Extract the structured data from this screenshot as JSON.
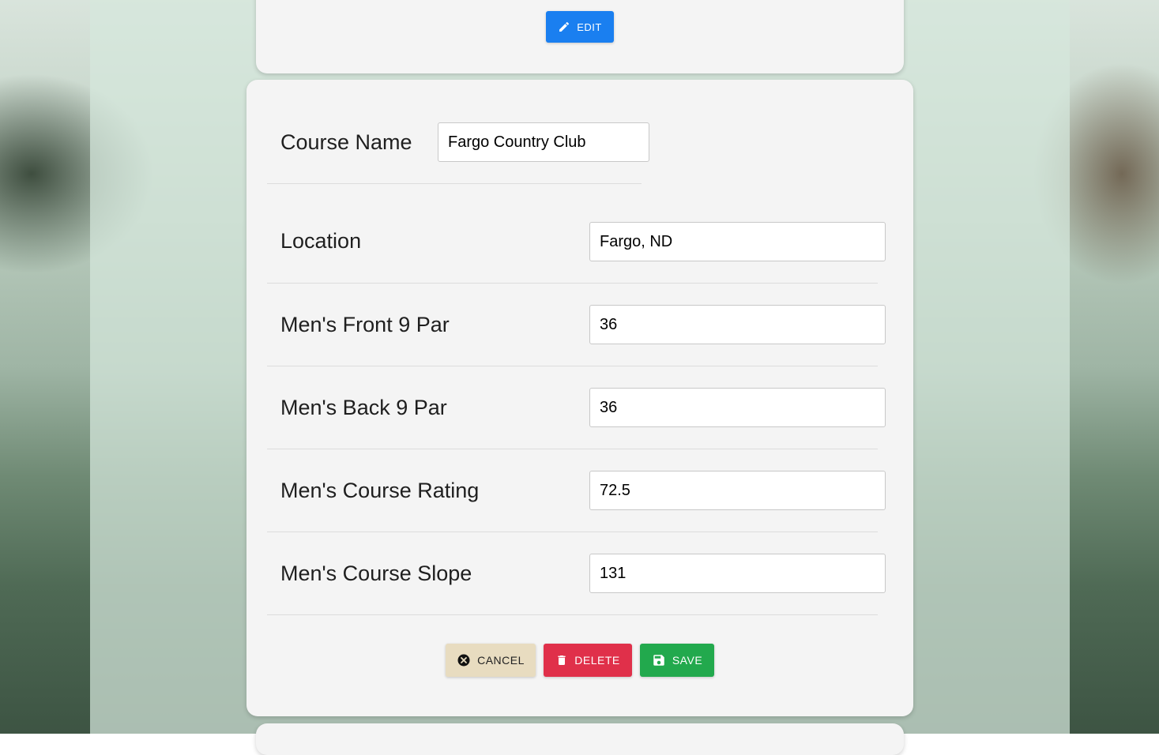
{
  "top_card": {
    "edit_label": "EDIT"
  },
  "form": {
    "fields": [
      {
        "label": "Course Name",
        "value": "Fargo Country Club"
      },
      {
        "label": "Location",
        "value": "Fargo, ND"
      },
      {
        "label": "Men's Front 9 Par",
        "value": "36"
      },
      {
        "label": "Men's Back 9 Par",
        "value": "36"
      },
      {
        "label": "Men's Course Rating",
        "value": "72.5"
      },
      {
        "label": "Men's Course Slope",
        "value": "131"
      }
    ]
  },
  "actions": {
    "cancel_label": "CANCEL",
    "delete_label": "DELETE",
    "save_label": "SAVE"
  },
  "colors": {
    "edit": "#1a7ff0",
    "cancel": "#e8dcc0",
    "delete": "#e0304a",
    "save": "#22a94d"
  },
  "icons": {
    "edit": "pencil-icon",
    "cancel": "close-circle-icon",
    "delete": "trash-icon",
    "save": "floppy-disk-icon"
  }
}
